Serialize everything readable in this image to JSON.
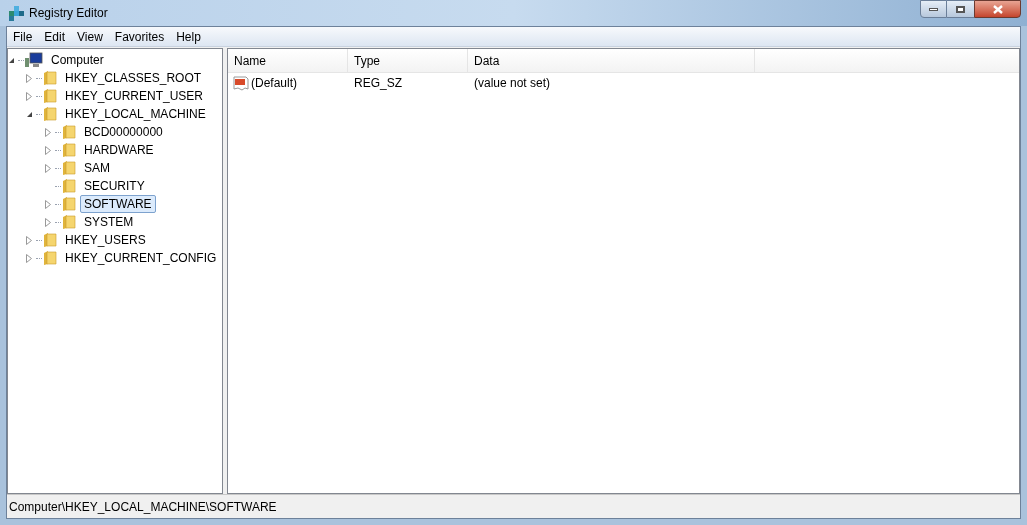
{
  "window": {
    "title": "Registry Editor"
  },
  "menu": [
    "File",
    "Edit",
    "View",
    "Favorites",
    "Help"
  ],
  "tree": {
    "label": "Computer",
    "expandable": true,
    "expanded": true,
    "selected": false,
    "children": [
      {
        "label": "HKEY_CLASSES_ROOT",
        "expandable": true,
        "expanded": false,
        "selected": false
      },
      {
        "label": "HKEY_CURRENT_USER",
        "expandable": true,
        "expanded": false,
        "selected": false
      },
      {
        "label": "HKEY_LOCAL_MACHINE",
        "expandable": true,
        "expanded": true,
        "selected": false,
        "children": [
          {
            "label": "BCD00000000",
            "expandable": true,
            "expanded": false,
            "selected": false
          },
          {
            "label": "HARDWARE",
            "expandable": true,
            "expanded": false,
            "selected": false
          },
          {
            "label": "SAM",
            "expandable": true,
            "expanded": false,
            "selected": false
          },
          {
            "label": "SECURITY",
            "expandable": false,
            "selected": false
          },
          {
            "label": "SOFTWARE",
            "expandable": true,
            "expanded": false,
            "selected": true
          },
          {
            "label": "SYSTEM",
            "expandable": true,
            "expanded": false,
            "selected": false
          }
        ]
      },
      {
        "label": "HKEY_USERS",
        "expandable": true,
        "expanded": false,
        "selected": false
      },
      {
        "label": "HKEY_CURRENT_CONFIG",
        "expandable": true,
        "expanded": false,
        "selected": false
      }
    ]
  },
  "table": {
    "columns": [
      "Name",
      "Type",
      "Data"
    ],
    "rows": [
      {
        "name": "(Default)",
        "type": "REG_SZ",
        "data": "(value not set)"
      }
    ]
  },
  "status_bar": "Computer\\HKEY_LOCAL_MACHINE\\SOFTWARE"
}
